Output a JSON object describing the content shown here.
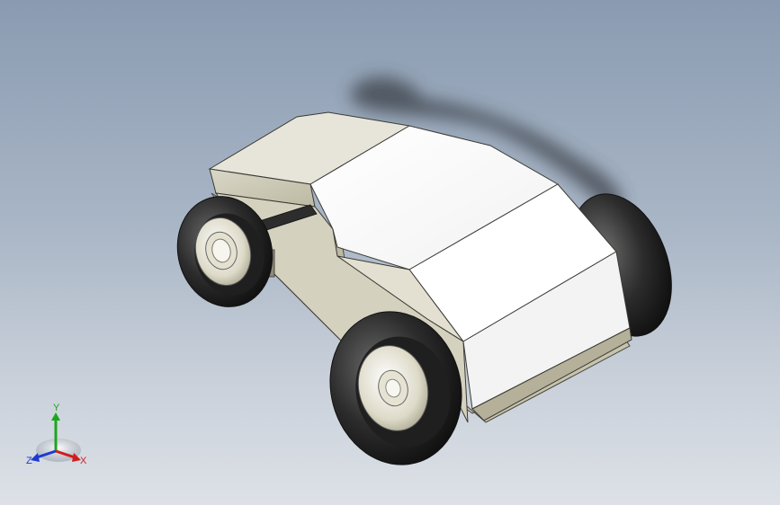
{
  "viewport": {
    "background_top": "#8a9bb1",
    "background_bottom": "#dde1e7"
  },
  "model": {
    "name_icon": "toy-car-model",
    "body_color": "#ffffff",
    "chassis_color": "#dcd8c4",
    "tire_color": "#2a2a2a",
    "hub_color": "#e8e6d6"
  },
  "triad": {
    "x_label": "X",
    "y_label": "Y",
    "z_label": "Z",
    "x_color": "#d21c1c",
    "y_color": "#1ca61c",
    "z_color": "#1c3ad2"
  }
}
